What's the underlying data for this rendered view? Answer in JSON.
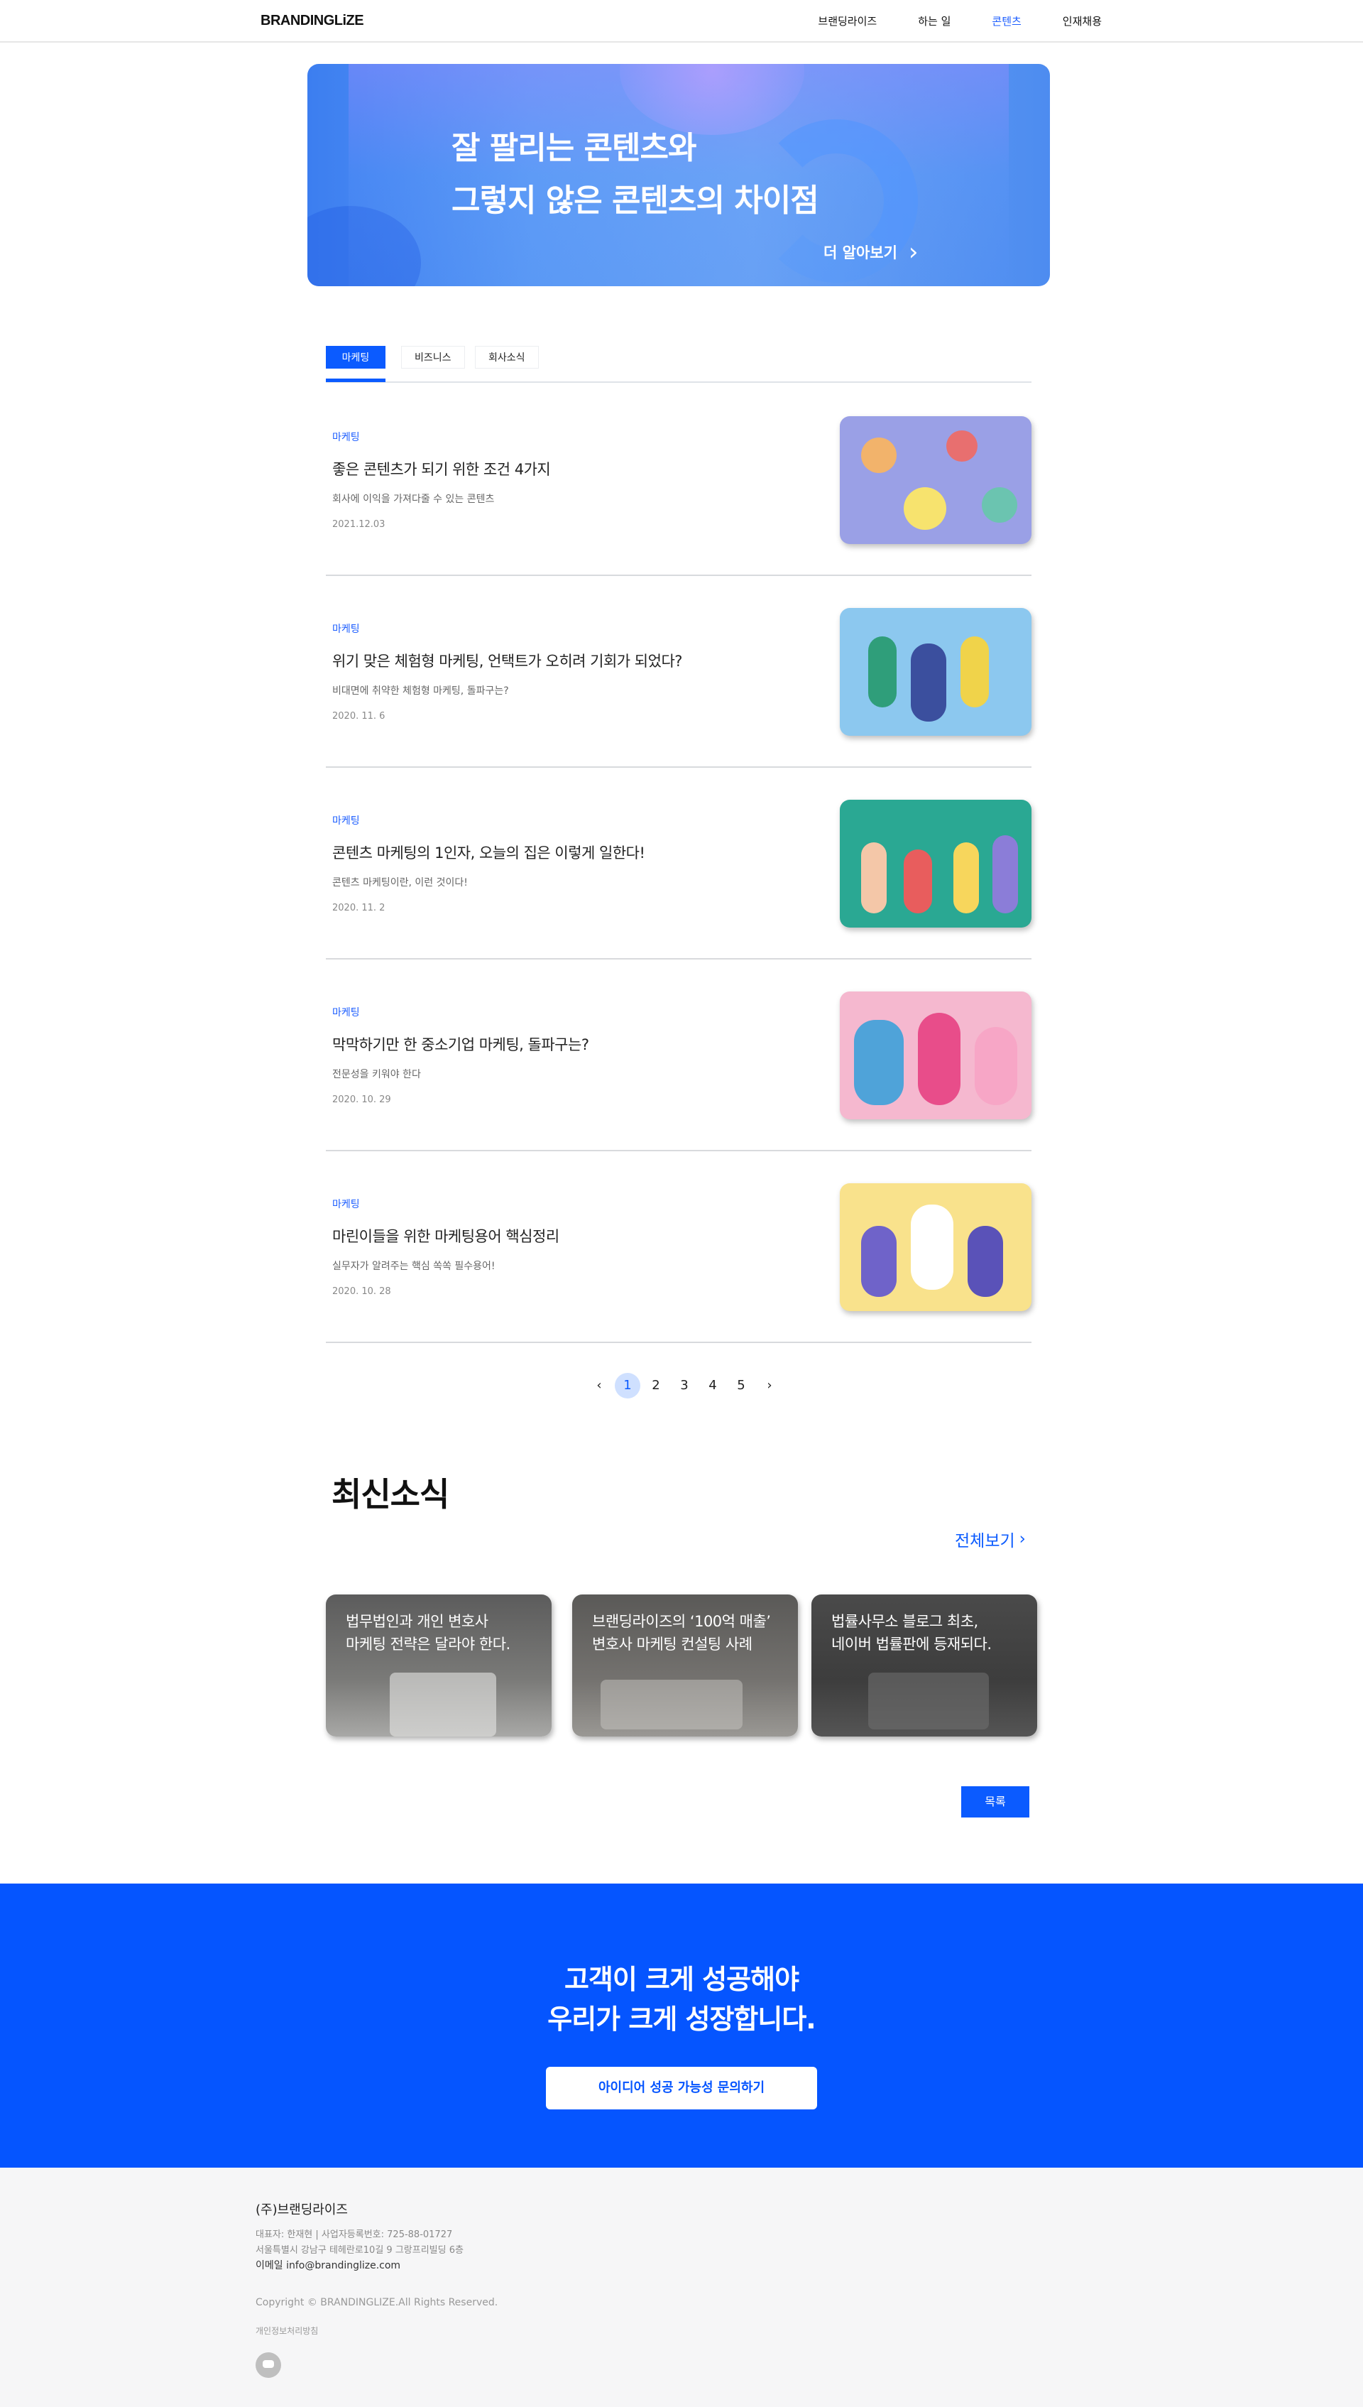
{
  "header": {
    "logo": "BRANDINGLiZE",
    "nav": [
      "브랜딩라이즈",
      "하는 일",
      "콘텐츠",
      "인재채용"
    ],
    "active_nav": "콘텐츠"
  },
  "hero": {
    "title": "잘 팔리는 콘텐츠와\n그렇지 않은 콘텐츠의 차이점",
    "more_label": "더 알아보기",
    "chevron": "›"
  },
  "tabs": [
    "마케팅",
    "비즈니스",
    "회사소식"
  ],
  "articles": [
    {
      "category": "마케팅",
      "title": "좋은 콘텐츠가 되기 위한 조건 4가지",
      "subtitle": "회사에 이익을 가져다줄 수 있는 콘텐츠",
      "date": "2021.12.03",
      "thumb_color": "#9aa0e6"
    },
    {
      "category": "마케팅",
      "title": "위기 맞은 체험형 마케팅, 언택트가 오히려 기회가 되었다?",
      "subtitle": "비대면에 취약한 체험형 마케팅, 돌파구는?",
      "date": "2020. 11. 6",
      "thumb_color": "#8cc8ef"
    },
    {
      "category": "마케팅",
      "title": "콘텐츠 마케팅의 1인자, 오늘의 집은 이렇게 일한다!",
      "subtitle": "콘텐츠 마케팅이란, 이런 것이다!",
      "date": "2020. 11. 2",
      "thumb_color": "#2aa893"
    },
    {
      "category": "마케팅",
      "title": "막막하기만 한 중소기업 마케팅, 돌파구는?",
      "subtitle": "전문성을 키워야 한다",
      "date": "2020. 10. 29",
      "thumb_color": "#f5b8cf"
    },
    {
      "category": "마케팅",
      "title": "마린이들을 위한 마케팅용어 핵심정리",
      "subtitle": "실무자가 알려주는 핵심 쏙쏙 필수용어!",
      "date": "2020. 10. 28",
      "thumb_color": "#f9e28c"
    }
  ],
  "pagination": {
    "prev": "‹",
    "pages": [
      "1",
      "2",
      "3",
      "4",
      "5"
    ],
    "current": "1",
    "next": "›"
  },
  "news": {
    "title": "최신소식",
    "view_all": "전체보기",
    "view_all_icon": "›",
    "cards": [
      {
        "text": "법무법인과 개인 변호사\n마케팅 전략은 달라야 한다."
      },
      {
        "text": "브랜딩라이즈의 ‘100억 매출’\n변호사 마케팅 컨설팅 사례"
      },
      {
        "text": "법률사무소 블로그 최초,\n네이버 법률판에 등재되다."
      }
    ]
  },
  "list_button": "목록",
  "cta": {
    "title": "고객이 크게 성공해야\n우리가 크게 성장합니다.",
    "button": "아이디어 성공 가능성 문의하기",
    "background": "#0555ff"
  },
  "footer": {
    "company": "(주)브랜딩라이즈",
    "line1": "대표자: 한재현  |  사업자등록번호: 725-88-01727",
    "line2": "서울특별시 강남구 테헤란로10길 9 그랑프리빌딩 6층",
    "email": "이메일 info@brandinglize.com",
    "copyright": "Copyright © BRANDINGLIZE.All Rights Reserved.",
    "privacy": "개인정보처리방침"
  },
  "colors": {
    "accent": "#0b5bff"
  }
}
